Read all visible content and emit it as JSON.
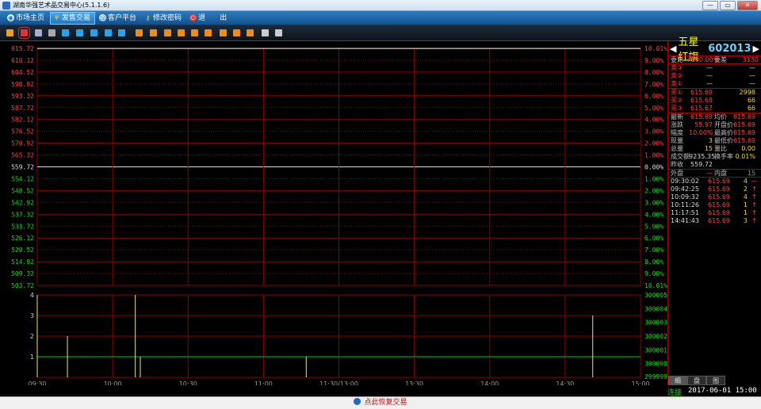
{
  "window": {
    "title": "湖南华强艺术品交易中心(5.1.1.6)",
    "controls": [
      "—",
      "▭",
      "✕"
    ]
  },
  "menu": [
    {
      "label": "市场主页",
      "icon": "globe-icon",
      "active": false
    },
    {
      "label": "发售交易",
      "icon": "yen-icon",
      "active": true
    },
    {
      "label": "客户平台",
      "icon": "at-icon",
      "active": false
    },
    {
      "label": "修改密码",
      "icon": "key-icon",
      "active": false
    },
    {
      "label": "退　　出",
      "icon": "power-icon",
      "active": false
    }
  ],
  "toolbar": {
    "icons": [
      {
        "name": "bar-chart-icon",
        "color": "#e8a020"
      },
      {
        "name": "line-chart-icon",
        "color": "#d33"
      },
      {
        "name": "candle-icon",
        "color": "#aac"
      },
      {
        "name": "list-icon",
        "color": "#aaa"
      },
      {
        "name": "tool-a-icon",
        "color": "#29a3e8"
      },
      {
        "name": "tool-b-icon",
        "color": "#29a3e8"
      },
      {
        "name": "tool-c-icon",
        "color": "#29a3e8"
      },
      {
        "name": "tool-d-icon",
        "color": "#29a3e8"
      },
      {
        "name": "tool-e-icon",
        "color": "#29a3e8"
      },
      {
        "name": "order-1-icon",
        "color": "#f28c0f"
      },
      {
        "name": "order-2-icon",
        "color": "#f28c0f"
      },
      {
        "name": "order-3-icon",
        "color": "#f28c0f"
      },
      {
        "name": "order-4-icon",
        "color": "#f28c0f"
      },
      {
        "name": "order-5-icon",
        "color": "#f28c0f"
      },
      {
        "name": "order-6-icon",
        "color": "#f28c0f"
      },
      {
        "name": "order-7-icon",
        "color": "#f28c0f"
      },
      {
        "name": "order-8-icon",
        "color": "#f28c0f"
      },
      {
        "name": "order-9-icon",
        "color": "#f28c0f"
      },
      {
        "name": "edit-icon",
        "color": "#ccc"
      },
      {
        "name": "settings-gear-icon",
        "color": "#ccc"
      }
    ]
  },
  "quote": {
    "name": "五星红旗",
    "code": "602013",
    "ratio_label": "委比",
    "ratio_value": "+100.00%",
    "diff_label": "委差",
    "diff_value": "3130",
    "asks": [
      {
        "label": "卖③",
        "price": "—",
        "vol": "—"
      },
      {
        "label": "卖②",
        "price": "—",
        "vol": "—"
      },
      {
        "label": "卖①",
        "price": "—",
        "vol": "—"
      }
    ],
    "bids": [
      {
        "label": "买①",
        "price": "615.69",
        "vol": "2998"
      },
      {
        "label": "买②",
        "price": "615.68",
        "vol": "66"
      },
      {
        "label": "买③",
        "price": "615.67",
        "vol": "66"
      }
    ],
    "stats": [
      {
        "l1": "最新",
        "v1": "615.69",
        "c1": "red",
        "l2": "均价",
        "v2": "615.69",
        "c2": "red"
      },
      {
        "l1": "涨跌",
        "v1": "55.97",
        "c1": "red",
        "l2": "开盘价",
        "v2": "615.69",
        "c2": "red"
      },
      {
        "l1": "幅度",
        "v1": "10.00%",
        "c1": "red",
        "l2": "最高价",
        "v2": "615.69",
        "c2": "red"
      },
      {
        "l1": "现量",
        "v1": "3",
        "c1": "yellow",
        "l2": "最低价",
        "v2": "615.69",
        "c2": "red"
      },
      {
        "l1": "总量",
        "v1": "15",
        "c1": "yellow",
        "l2": "量比",
        "v2": "0.00",
        "c2": "yellow"
      },
      {
        "l1": "成交额",
        "v1": "9235.35",
        "c1": "white",
        "l2": "换手率",
        "v2": "0.01%",
        "c2": "yellow"
      },
      {
        "l1": "昨收",
        "v1": "559.72",
        "c1": "white",
        "l2": "",
        "v2": "",
        "c2": "white"
      }
    ],
    "outer_label": "外盘",
    "outer_value": "—",
    "inner_label": "内盘",
    "inner_value": "15",
    "ticks": [
      {
        "time": "09:30:02",
        "price": "615.69",
        "vol": "4",
        "dir": "—"
      },
      {
        "time": "09:42:25",
        "price": "615.69",
        "vol": "2",
        "dir": "↑"
      },
      {
        "time": "10:09:32",
        "price": "615.69",
        "vol": "4",
        "dir": "↑"
      },
      {
        "time": "10:11:26",
        "price": "615.69",
        "vol": "1",
        "dir": "↑"
      },
      {
        "time": "11:17:51",
        "price": "615.69",
        "vol": "1",
        "dir": "↑"
      },
      {
        "time": "14:41:43",
        "price": "615.69",
        "vol": "3",
        "dir": "↑"
      }
    ],
    "tabs": [
      "细",
      "盘",
      "图"
    ]
  },
  "status": {
    "connection": "连接",
    "datetime": "2017-06-01  15:00"
  },
  "bottom": {
    "restore_label": "点此恢复交易"
  },
  "colors": {
    "up": "#ff3c3c",
    "down": "#00e000",
    "grid": "#8b0000",
    "price_line": "#ffffff"
  },
  "chart_data": {
    "type": "line",
    "price_axis_left": [
      "615.72",
      "610.12",
      "604.52",
      "598.92",
      "593.32",
      "587.72",
      "582.12",
      "576.52",
      "570.92",
      "565.32",
      "559.72",
      "554.12",
      "548.52",
      "542.92",
      "537.32",
      "531.72",
      "526.12",
      "520.52",
      "514.92",
      "509.32",
      "503.72"
    ],
    "price_axis_right": [
      "10.01%",
      "9.00%",
      "8.00%",
      "7.00%",
      "6.00%",
      "5.00%",
      "4.00%",
      "3.00%",
      "2.00%",
      "1.00%",
      "0.00%",
      "1.00%",
      "2.00%",
      "3.00%",
      "4.00%",
      "5.00%",
      "6.00%",
      "7.00%",
      "8.00%",
      "9.00%",
      "10.01%"
    ],
    "price_ylim": [
      503.72,
      615.72
    ],
    "prev_close": 559.72,
    "price_series": [
      {
        "x": "09:30",
        "y": 615.69
      },
      {
        "x": "15:00",
        "y": 615.69
      }
    ],
    "x_ticks": [
      "09:30",
      "10:00",
      "10:30",
      "11:00",
      "11:30/13:00",
      "13:30",
      "14:00",
      "14:30",
      "15:00"
    ],
    "volume_axis_left": [
      "4",
      "3",
      "2",
      "1"
    ],
    "volume_axis_right": [
      "300005",
      "300004",
      "300003",
      "300002",
      "300001",
      "300000",
      "299999"
    ],
    "volume_ylim": [
      0,
      4
    ],
    "volume_bars": [
      {
        "x": "09:30",
        "v": 4
      },
      {
        "x": "09:42",
        "v": 2
      },
      {
        "x": "10:09",
        "v": 4
      },
      {
        "x": "10:11",
        "v": 1
      },
      {
        "x": "11:17",
        "v": 1
      },
      {
        "x": "14:41",
        "v": 3
      }
    ],
    "avg_volume_line": 1
  }
}
